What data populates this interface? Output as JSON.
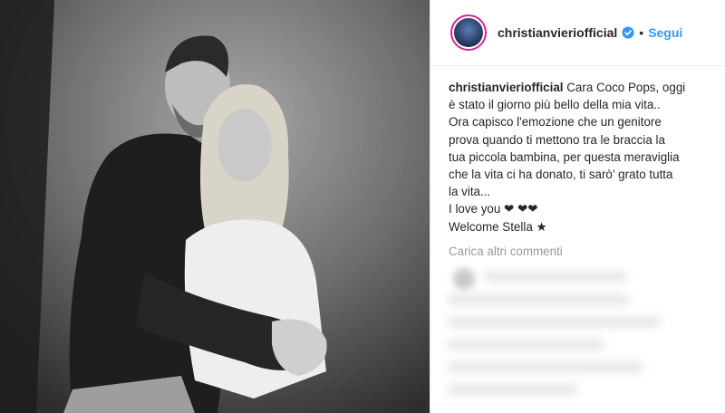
{
  "post": {
    "username": "christianvieriofficial",
    "dot": "•",
    "follow_label": "Segui",
    "caption_lines": [
      "Cara Coco Pops, oggi",
      "è stato il giorno più bello della mia vita..",
      "Ora capisco l'emozione che un genitore",
      "prova quando ti mettono tra le braccia la",
      "tua piccola bambina, per questa meraviglia",
      "che la vita ci ha donato, ti sarò' grato tutta",
      "la vita...",
      "I love you ❤ ❤❤",
      "Welcome Stella ★"
    ],
    "load_more_label": "Carica altri commenti"
  },
  "colors": {
    "link": "#3897f0",
    "verified": "#3897f0",
    "text": "#262626",
    "muted": "#999999"
  },
  "icons": {
    "verified": "verified-badge-icon"
  }
}
